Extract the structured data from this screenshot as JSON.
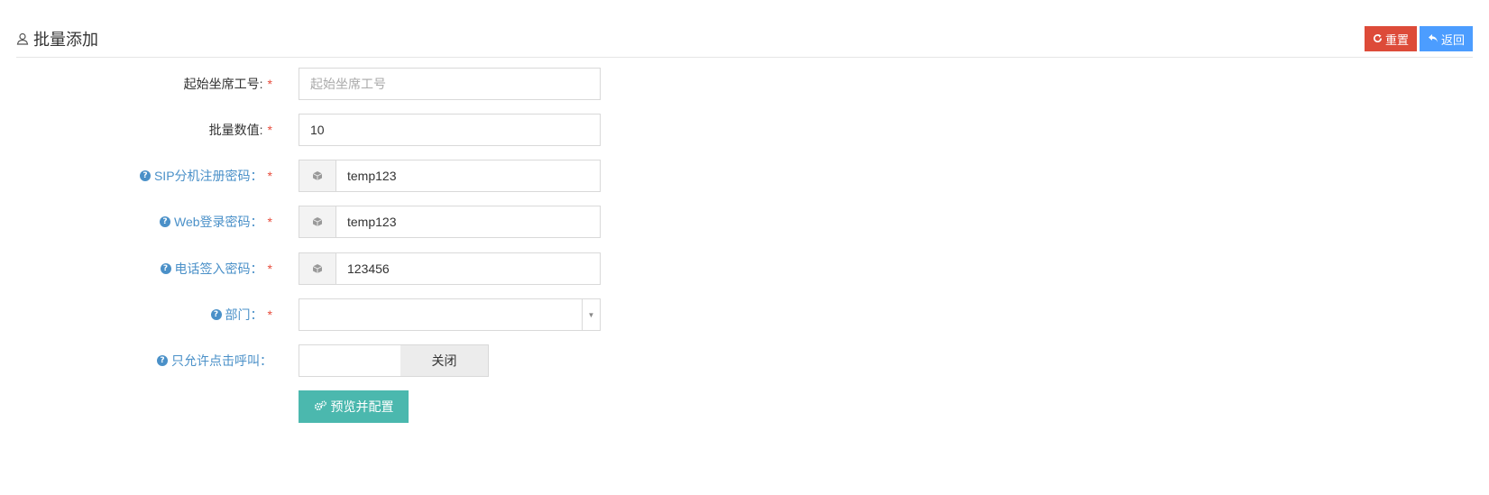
{
  "header": {
    "title": "批量添加",
    "title_icon": "user-outline-icon",
    "reset_label": "重置",
    "back_label": "返回",
    "reset_color": "#dd4b39",
    "back_color": "#4c9dff"
  },
  "form": {
    "start_id": {
      "label": "起始坐席工号:",
      "required": "*",
      "placeholder": "起始坐席工号",
      "value": ""
    },
    "batch_count": {
      "label": "批量数值:",
      "required": "*",
      "value": "10"
    },
    "sip_password": {
      "label": "SIP分机注册密码：",
      "required": "*",
      "value": "temp123",
      "addon_icon": "cube-icon"
    },
    "web_password": {
      "label": "Web登录密码：",
      "required": "*",
      "value": "temp123",
      "addon_icon": "cube-icon"
    },
    "phone_password": {
      "label": "电话签入密码：",
      "required": "*",
      "value": "123456",
      "addon_icon": "cube-icon"
    },
    "department": {
      "label": "部门：",
      "required": "*",
      "value": ""
    },
    "click_call_only": {
      "label": "只允许点击呼叫：",
      "toggle_state": "关闭"
    },
    "submit_label": "预览并配置",
    "submit_color": "#4bb8ae"
  }
}
